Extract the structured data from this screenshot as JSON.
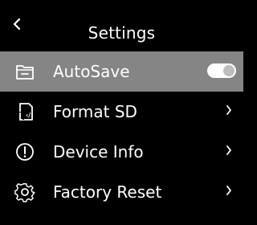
{
  "header": {
    "title": "Settings",
    "back_icon": "chevron-left-icon"
  },
  "menu": {
    "items": [
      {
        "label": "AutoSave",
        "icon": "folder-icon",
        "control": "toggle",
        "toggle_on": true,
        "selected": true
      },
      {
        "label": "Format SD",
        "icon": "sd-card-icon",
        "control": "chevron"
      },
      {
        "label": "Device Info",
        "icon": "info-icon",
        "control": "chevron"
      },
      {
        "label": "Factory Reset",
        "icon": "gear-icon",
        "control": "chevron"
      }
    ]
  },
  "colors": {
    "background": "#000000",
    "selected_row": "#858585",
    "text": "#ffffff",
    "toggle_track": "#ffffff",
    "toggle_knob": "#bdbdbd"
  }
}
